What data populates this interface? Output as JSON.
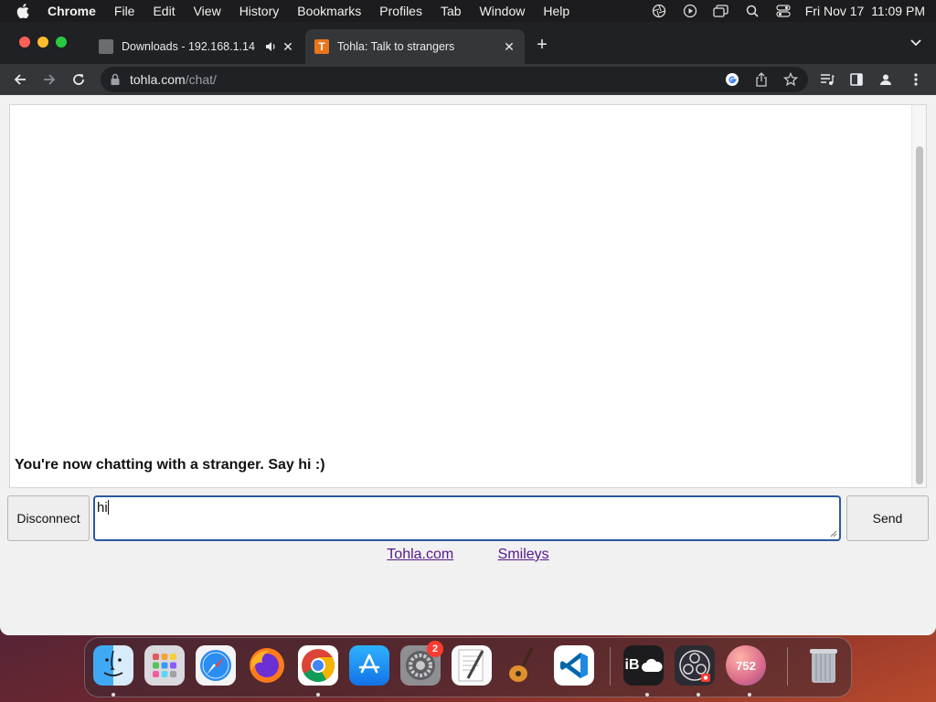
{
  "menubar": {
    "app_name": "Chrome",
    "items": [
      "File",
      "Edit",
      "View",
      "History",
      "Bookmarks",
      "Profiles",
      "Tab",
      "Window",
      "Help"
    ],
    "clock": "Fri Nov 17  11:09 PM"
  },
  "tabs": [
    {
      "title": "Downloads - 192.168.1.14",
      "icon": "folder-icon"
    },
    {
      "title": "Tohla: Talk to strangers",
      "icon": "tohla-favicon",
      "favicon_letter": "T"
    }
  ],
  "address_bar": {
    "domain": "tohla.com",
    "path": "/chat/"
  },
  "chat": {
    "status_message": "You're now chatting with a stranger. Say hi :)",
    "disconnect_label": "Disconnect",
    "message_value": "hi",
    "send_label": "Send"
  },
  "footer_links": {
    "home": "Tohla.com",
    "smileys": "Smileys"
  },
  "dock": {
    "apps": [
      "Finder",
      "Launchpad",
      "Safari",
      "Firefox",
      "Chrome",
      "App Store",
      "System Preferences",
      "TextEdit",
      "GarageBand",
      "VS Code",
      "iCloud",
      "OBS",
      "752",
      "Trash"
    ],
    "settings_badge": "2",
    "icloud_label": "iB",
    "counter_label": "752"
  },
  "colors": {
    "accent_focus": "#2a5a9e",
    "link": "#551a8b",
    "badge": "#ff3b30"
  }
}
